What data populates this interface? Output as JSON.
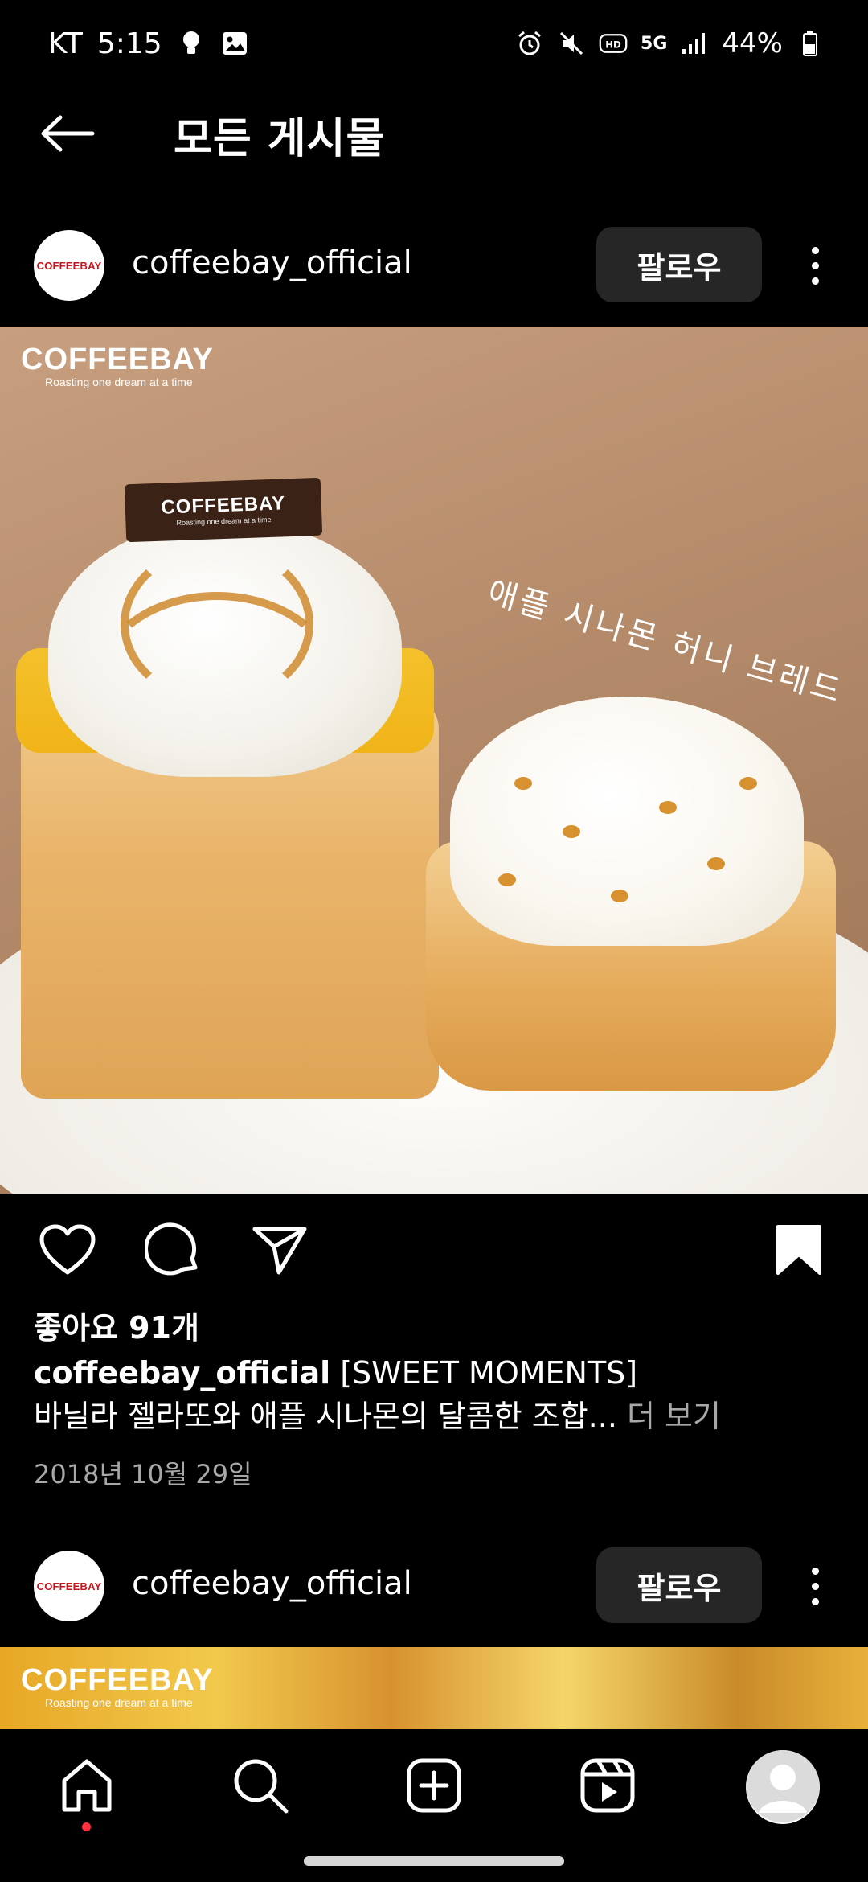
{
  "status_bar": {
    "carrier": "KT",
    "time": "5:15",
    "network": "5G",
    "battery": "44%"
  },
  "header": {
    "title": "모든 게시물"
  },
  "posts": [
    {
      "username": "coffeebay_official",
      "avatar_text": "COFFEEBAY",
      "follow_label": "팔로우",
      "image": {
        "brand": "COFFEEBAY",
        "tagline": "Roasting one dream at a time",
        "chocolate_brand": "COFFEEBAY",
        "chocolate_tagline": "Roasting one dream at a time",
        "handwriting": "애플 시나몬 허니 브레드"
      },
      "likes": "좋아요 91개",
      "caption_title": "[SWEET MOMENTS]",
      "caption_text": "바닐라 젤라또와 애플 시나몬의 달콤한 조합...",
      "more_label": "더 보기",
      "date": "2018년 10월 29일"
    },
    {
      "username": "coffeebay_official",
      "avatar_text": "COFFEEBAY",
      "follow_label": "팔로우",
      "image": {
        "brand": "COFFEEBAY",
        "tagline": "Roasting one dream at a time"
      }
    }
  ],
  "icons": {
    "back": "arrow-left-icon",
    "like": "heart-icon",
    "comment": "comment-icon",
    "share": "send-icon",
    "save": "bookmark-icon",
    "more": "more-vertical-icon",
    "nav": [
      "home-icon",
      "search-icon",
      "add-post-icon",
      "reels-icon",
      "profile-icon"
    ]
  },
  "colors": {
    "background": "#000000",
    "follow_button": "#262626",
    "muted_text": "#a8a8a8",
    "notification_dot": "#ff3040"
  }
}
